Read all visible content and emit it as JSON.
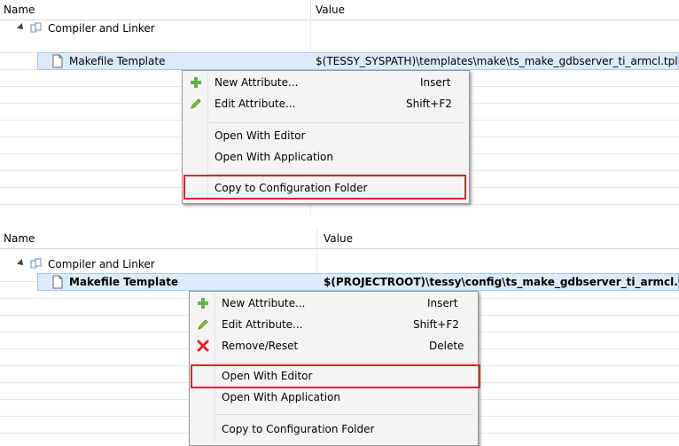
{
  "columns": {
    "name": "Name",
    "value": "Value"
  },
  "top": {
    "tree": {
      "group_label": "Compiler and Linker",
      "item_label": "Makefile Template",
      "item_value": "$(TESSY_SYSPATH)\\templates\\make\\ts_make_gdbserver_ti_armcl.tpl"
    },
    "menu": {
      "items": [
        {
          "label": "New Attribute...",
          "shortcut": "Insert",
          "icon": "plus-icon"
        },
        {
          "label": "Edit Attribute...",
          "shortcut": "Shift+F2",
          "icon": "pencil-icon"
        },
        {
          "label": "Open With Editor",
          "shortcut": ""
        },
        {
          "label": "Open With Application",
          "shortcut": ""
        },
        {
          "label": "Copy to Configuration Folder",
          "shortcut": ""
        }
      ]
    }
  },
  "bottom": {
    "tree": {
      "group_label": "Compiler and Linker",
      "item_label": "Makefile Template",
      "item_value": "$(PROJECTROOT)\\tessy\\config\\ts_make_gdbserver_ti_armcl.tpl"
    },
    "menu": {
      "items": [
        {
          "label": "New Attribute...",
          "shortcut": "Insert",
          "icon": "plus-icon"
        },
        {
          "label": "Edit Attribute...",
          "shortcut": "Shift+F2",
          "icon": "pencil-icon"
        },
        {
          "label": "Remove/Reset",
          "shortcut": "Delete",
          "icon": "red-x-icon"
        },
        {
          "label": "Open With Editor",
          "shortcut": ""
        },
        {
          "label": "Open With Application",
          "shortcut": ""
        },
        {
          "label": "Copy to Configuration Folder",
          "shortcut": ""
        }
      ]
    }
  },
  "colors": {
    "highlight": "#d9262b",
    "selection": "#dceaf9",
    "menu_bg": "#f4f4f4"
  }
}
